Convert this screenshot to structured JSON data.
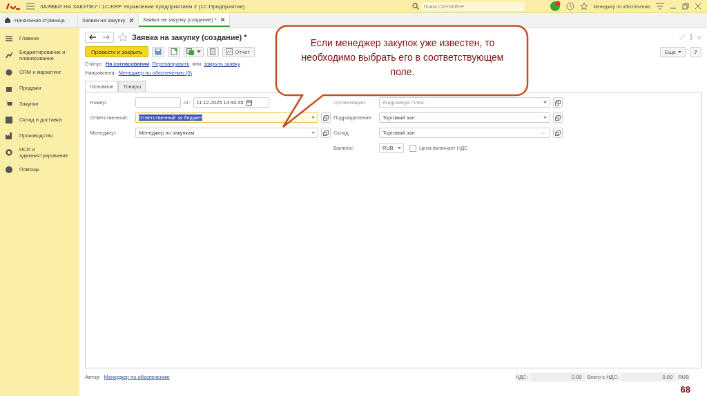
{
  "title_bar": {
    "title": "ЗАЯВКИ НА ЗАКУПКУ / 1С:ERP Управление предприятием 2  (1С:Предприятие)",
    "search_placeholder": "Поиск Ctrl+Shift+F",
    "user": "Менеджер по обеспечению"
  },
  "tabs": [
    {
      "label": "Начальная страница",
      "kind": "home",
      "selected": false
    },
    {
      "label": "Заявки на закупку",
      "kind": "doc",
      "selected": false
    },
    {
      "label": "Заявка на закупку (создание) *",
      "kind": "doc",
      "selected": true
    }
  ],
  "sidebar": {
    "items": [
      {
        "label": "Главное"
      },
      {
        "label": "Бюджетирование и планирование"
      },
      {
        "label": "CRM и маркетинг"
      },
      {
        "label": "Продажи"
      },
      {
        "label": "Закупки"
      },
      {
        "label": "Склад и доставка"
      },
      {
        "label": "Производство"
      },
      {
        "label": "НСИ и администрирование"
      },
      {
        "label": "Помощь"
      }
    ]
  },
  "form": {
    "title": "Заявка на закупку (создание) *",
    "post_button": "Провести и закрыть",
    "reports_button": "Отчет",
    "more_button": "Еще",
    "help_button": "?",
    "status": {
      "label": "Статус:",
      "value": "На согласовании",
      "redirect": "Перенаправить",
      "or": "или",
      "close": "закрыть заявку"
    },
    "directed": {
      "label": "Направлена:",
      "value": "Менеджер по обеспечению (0)"
    },
    "tabs": [
      {
        "label": "Основное",
        "selected": true
      },
      {
        "label": "Товары",
        "selected": false
      }
    ],
    "number": {
      "label": "Номер:",
      "date_label": "от:",
      "date": "11.12.2025 14:44:45"
    },
    "left_fields": [
      {
        "label": "Ответственный:",
        "value": "Ответственный за бюджет",
        "focused": true
      },
      {
        "label": "Менеджер:",
        "value": "Менеджер по закупкам",
        "focused": false
      }
    ],
    "right_fields": [
      {
        "label": "Организация:",
        "value": "Андромеда Плюс",
        "dimmed": true,
        "kind": "dropdown"
      },
      {
        "label": "Подразделение:",
        "value": "Торговый зал",
        "dimmed": false,
        "kind": "dropdown"
      },
      {
        "label": "Склад:",
        "value": "Торговый зал",
        "dimmed": false,
        "kind": "select"
      }
    ],
    "currency": {
      "label": "Валюта:",
      "value": "RUB",
      "vat_checkbox": {
        "label": "Цена включает НДС",
        "checked": false
      }
    },
    "footer": {
      "author_label": "Автор:",
      "author": "Менеджер по обеспечению",
      "vat_label": "НДС:",
      "vat": "0.00",
      "total_label": "Всего с НДС:",
      "total": "0.00",
      "currency": "RUB"
    }
  },
  "callout": {
    "text": "Если менеджер закупок уже известен, то необходимо выбрать его в соответствующем поле."
  },
  "slide_number": "68"
}
